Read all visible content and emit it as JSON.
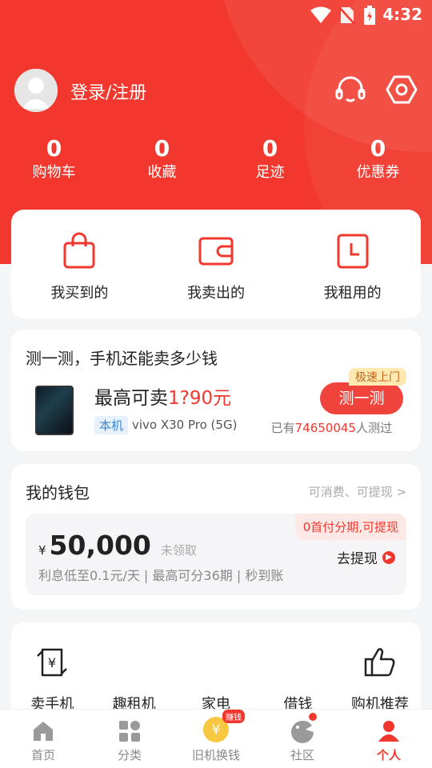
{
  "status_bar": {
    "time": "4:32",
    "icons": [
      "wifi-icon",
      "no-sim-icon",
      "battery-icon"
    ]
  },
  "header": {
    "login_label": "登录/注册",
    "icons": [
      "headset-icon",
      "settings-icon"
    ]
  },
  "stats": [
    {
      "value": "0",
      "label": "购物车"
    },
    {
      "value": "0",
      "label": "收藏"
    },
    {
      "value": "0",
      "label": "足迹"
    },
    {
      "value": "0",
      "label": "优惠券"
    }
  ],
  "orders": [
    {
      "label": "我买到的",
      "icon": "shopping-bag-icon"
    },
    {
      "label": "我卖出的",
      "icon": "wallet-icon"
    },
    {
      "label": "我租用的",
      "icon": "clock-icon"
    }
  ],
  "evaluation": {
    "title": "测一测，手机还能卖多少钱",
    "price_prefix": "最高可卖",
    "price_value": "1?90元",
    "device_tag": "本机",
    "device_model": "vivo X30 Pro (5G)",
    "fast_badge": "极速上门",
    "button_label": "测一测",
    "tested_prefix": "已有",
    "tested_count": "74650045",
    "tested_suffix": "人测过"
  },
  "wallet": {
    "title": "我的钱包",
    "more_label": "可消费、可提现 >",
    "currency": "¥",
    "amount": "50,000",
    "amount_note": "未领取",
    "desc": "利息低至0.1元/天 | 最高可分36期 | 秒到账",
    "badge": "0首付分期,可提现",
    "withdraw_label": "去提现"
  },
  "services": [
    {
      "label": "卖手机",
      "icon": "sell-phone-icon"
    },
    {
      "label": "趣租机",
      "icon": ""
    },
    {
      "label": "家电",
      "icon": ""
    },
    {
      "label": "借钱",
      "icon": ""
    },
    {
      "label": "购机推荐",
      "icon": "thumbs-up-icon"
    }
  ],
  "tabbar": [
    {
      "label": "首页",
      "icon": "home-icon"
    },
    {
      "label": "分类",
      "icon": "category-icon"
    },
    {
      "label": "旧机换钱",
      "icon": "yuan-coin-icon",
      "badge": "赚钱"
    },
    {
      "label": "社区",
      "icon": "community-icon"
    },
    {
      "label": "个人",
      "icon": "person-icon",
      "active": true
    }
  ],
  "colors": {
    "brand_red": "#f2382e",
    "background": "#f4f5f7",
    "blue_tag": "#3a86d9"
  }
}
